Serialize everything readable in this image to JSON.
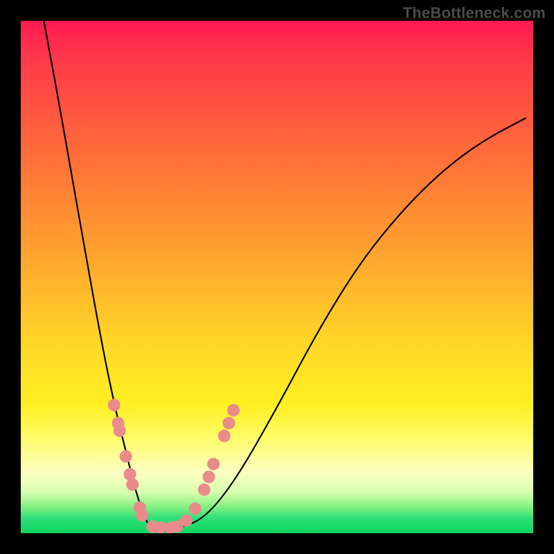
{
  "watermark": "TheBottleneck.com",
  "chart_data": {
    "type": "line",
    "title": "",
    "xlabel": "",
    "ylabel": "",
    "xlim": [
      0,
      1
    ],
    "ylim": [
      0,
      1
    ],
    "note": "Decorative bottleneck V-curve over red→green vertical gradient. No numeric axes visible; x/y normalized 0–1 with y=0 at bottom.",
    "series": [
      {
        "name": "curve",
        "x": [
          0.045,
          0.08,
          0.12,
          0.16,
          0.185,
          0.21,
          0.225,
          0.24,
          0.25,
          0.26,
          0.28,
          0.31,
          0.36,
          0.42,
          0.5,
          0.58,
          0.66,
          0.74,
          0.82,
          0.9,
          0.985
        ],
        "y": [
          1.0,
          0.81,
          0.58,
          0.36,
          0.24,
          0.14,
          0.08,
          0.035,
          0.015,
          0.01,
          0.01,
          0.01,
          0.03,
          0.105,
          0.245,
          0.395,
          0.525,
          0.625,
          0.705,
          0.765,
          0.81
        ]
      }
    ],
    "markers": {
      "name": "dots",
      "color": "#e98b8b",
      "points_xy": [
        [
          0.182,
          0.25
        ],
        [
          0.19,
          0.215
        ],
        [
          0.193,
          0.2
        ],
        [
          0.205,
          0.15
        ],
        [
          0.213,
          0.115
        ],
        [
          0.218,
          0.095
        ],
        [
          0.232,
          0.05
        ],
        [
          0.237,
          0.035
        ],
        [
          0.257,
          0.013
        ],
        [
          0.272,
          0.011
        ],
        [
          0.292,
          0.011
        ],
        [
          0.305,
          0.013
        ],
        [
          0.323,
          0.025
        ],
        [
          0.34,
          0.048
        ],
        [
          0.358,
          0.085
        ],
        [
          0.367,
          0.11
        ],
        [
          0.376,
          0.135
        ],
        [
          0.397,
          0.19
        ],
        [
          0.406,
          0.215
        ],
        [
          0.415,
          0.24
        ]
      ]
    }
  }
}
